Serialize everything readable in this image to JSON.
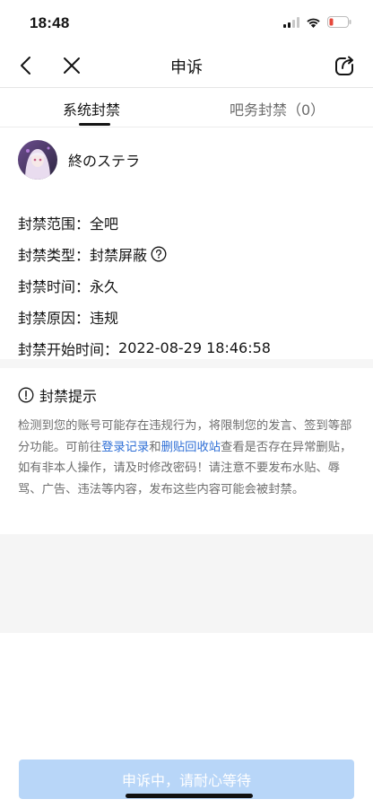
{
  "status": {
    "time": "18:48",
    "icons": [
      "signal-icon",
      "wifi-icon",
      "battery-icon"
    ],
    "battery_color": "#e5483b"
  },
  "nav": {
    "title": "申诉",
    "icons": [
      "back-arrow-icon",
      "close-icon",
      "share-icon"
    ]
  },
  "tabs": [
    {
      "label": "系统封禁",
      "active": true
    },
    {
      "label": "吧务封禁（0）",
      "active": false
    }
  ],
  "user": {
    "name": "終のステラ"
  },
  "ban_info": {
    "scope_label": "封禁范围：",
    "scope_value": "全吧",
    "type_label": "封禁类型：",
    "type_value": "封禁屏蔽",
    "duration_label": "封禁时间：",
    "duration_value": "永久",
    "reason_label": "封禁原因：",
    "reason_value": "违规",
    "start_label": "封禁开始时间：",
    "start_value": "2022-08-29 18:46:58"
  },
  "notice": {
    "title": "封禁提示",
    "text_1": "检测到您的账号可能存在违规行为，将限制您的发言、签到等部分功能。可前往",
    "link_login": "登录记录",
    "text_and": "和",
    "link_recycle": "删贴回收站",
    "text_2": "查看是否存在异常删贴，如有非本人操作，请及时修改密码！请注意不要发布水贴、辱骂、广告、违法等内容，发布这些内容可能会被封禁。"
  },
  "footer": {
    "button_label": "申诉中，请耐心等待"
  },
  "colors": {
    "link": "#2f6fd6",
    "button_bg": "#b8d6f8"
  }
}
